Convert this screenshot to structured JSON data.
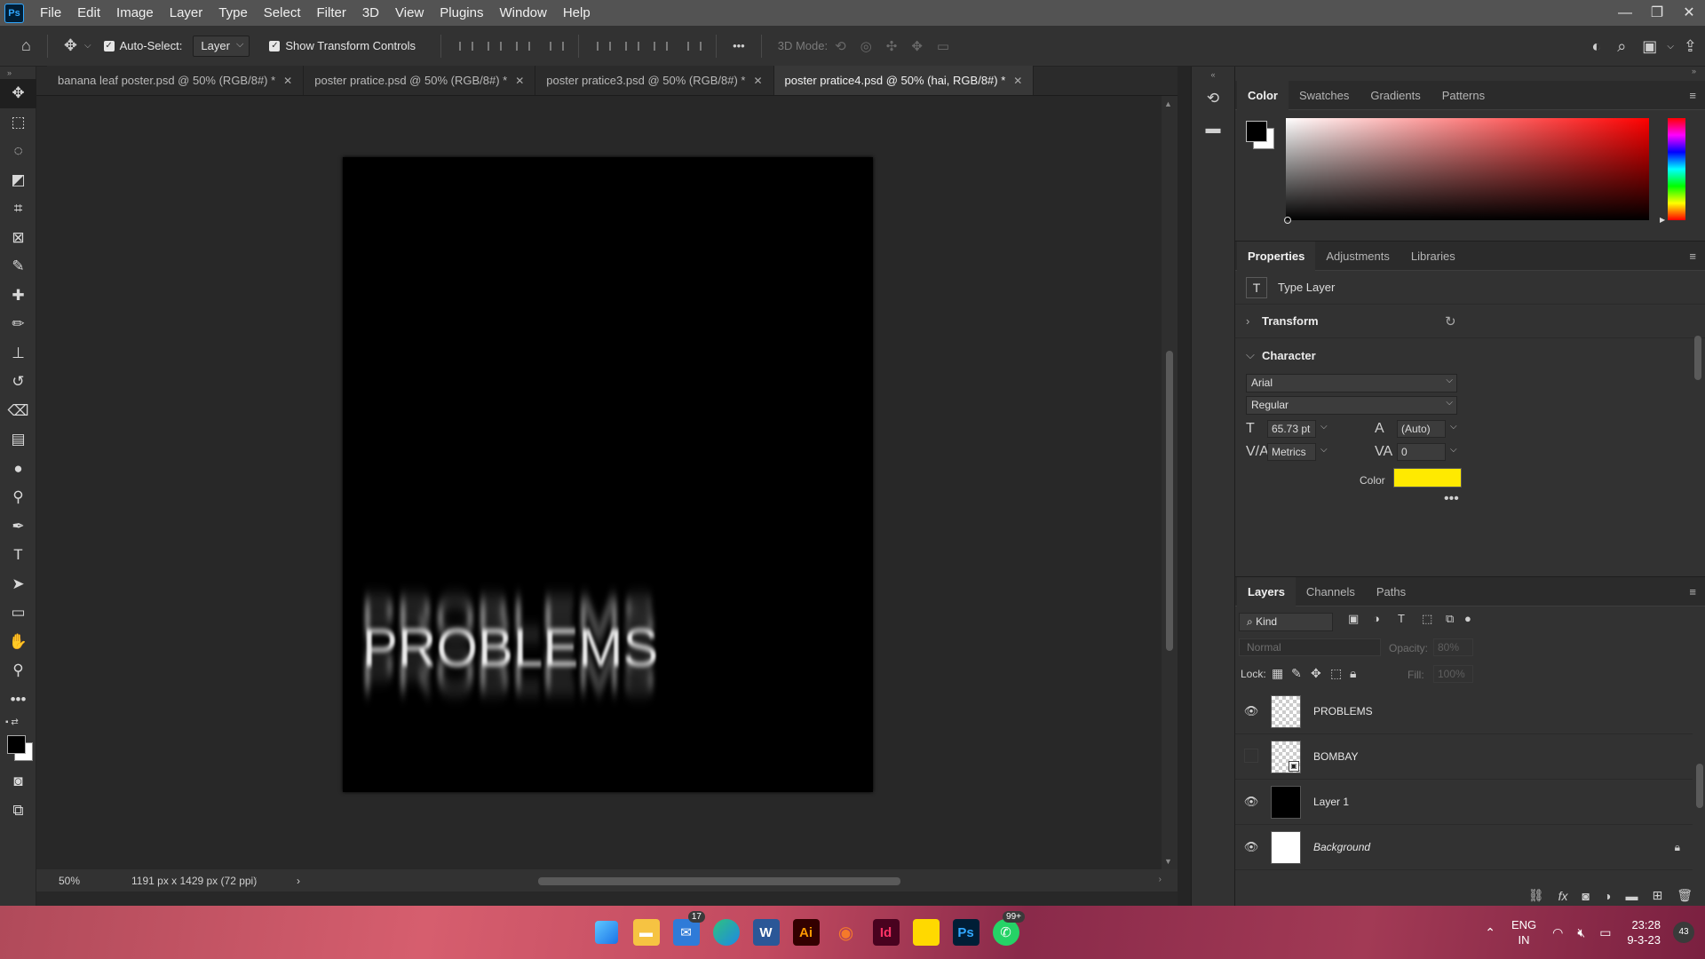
{
  "app": {
    "logo": "Ps",
    "menus": [
      "File",
      "Edit",
      "Image",
      "Layer",
      "Type",
      "Select",
      "Filter",
      "3D",
      "View",
      "Plugins",
      "Window",
      "Help"
    ]
  },
  "options": {
    "auto_select_label": "Auto-Select:",
    "auto_select_value": "Layer",
    "show_transform_label": "Show Transform Controls",
    "mode_3d_label": "3D Mode:",
    "more": "•••"
  },
  "tabs": [
    {
      "label": "banana leaf poster.psd @ 50% (RGB/8#) *"
    },
    {
      "label": "poster pratice.psd @ 50% (RGB/8#) *"
    },
    {
      "label": "poster pratice3.psd @ 50% (RGB/8#) *"
    },
    {
      "label": "poster pratice4.psd @ 50% (hai, RGB/8#) *"
    }
  ],
  "canvas": {
    "text": "PROBLEMS"
  },
  "status": {
    "zoom": "50%",
    "doc_info": "1191 px x 1429 px (72 ppi)"
  },
  "color_panel": {
    "tabs": [
      "Color",
      "Swatches",
      "Gradients",
      "Patterns"
    ]
  },
  "props_panel": {
    "tabs": [
      "Properties",
      "Adjustments",
      "Libraries"
    ],
    "type_layer_label": "Type Layer",
    "transform_label": "Transform",
    "character_label": "Character",
    "font_family": "Arial",
    "font_style": "Regular",
    "font_size": "65.73 pt",
    "leading": "(Auto)",
    "kerning": "Metrics",
    "tracking": "0",
    "color_label": "Color",
    "color_value": "#ffea00",
    "more": "•••"
  },
  "layers_panel": {
    "tabs": [
      "Layers",
      "Channels",
      "Paths"
    ],
    "kind": "Kind",
    "blend_mode": "Normal",
    "opacity_label": "Opacity:",
    "opacity_value": "80%",
    "lock_label": "Lock:",
    "fill_label": "Fill:",
    "fill_value": "100%",
    "layers": [
      {
        "name": "PROBLEMS",
        "visible": true
      },
      {
        "name": "BOMBAY",
        "visible": false
      },
      {
        "name": "Layer 1",
        "visible": true
      },
      {
        "name": "Background",
        "visible": true
      }
    ]
  },
  "taskbar": {
    "mail_badge": "17",
    "whatsapp_badge": "99+",
    "lang_top": "ENG",
    "lang_bottom": "IN",
    "time": "23:28",
    "date": "9-3-23",
    "notif_count": "43",
    "app_icons": [
      "windows-start",
      "file-explorer",
      "mail",
      "edge",
      "word",
      "illustrator",
      "blender",
      "indesign",
      "sticky-notes",
      "photoshop",
      "whatsapp"
    ]
  }
}
